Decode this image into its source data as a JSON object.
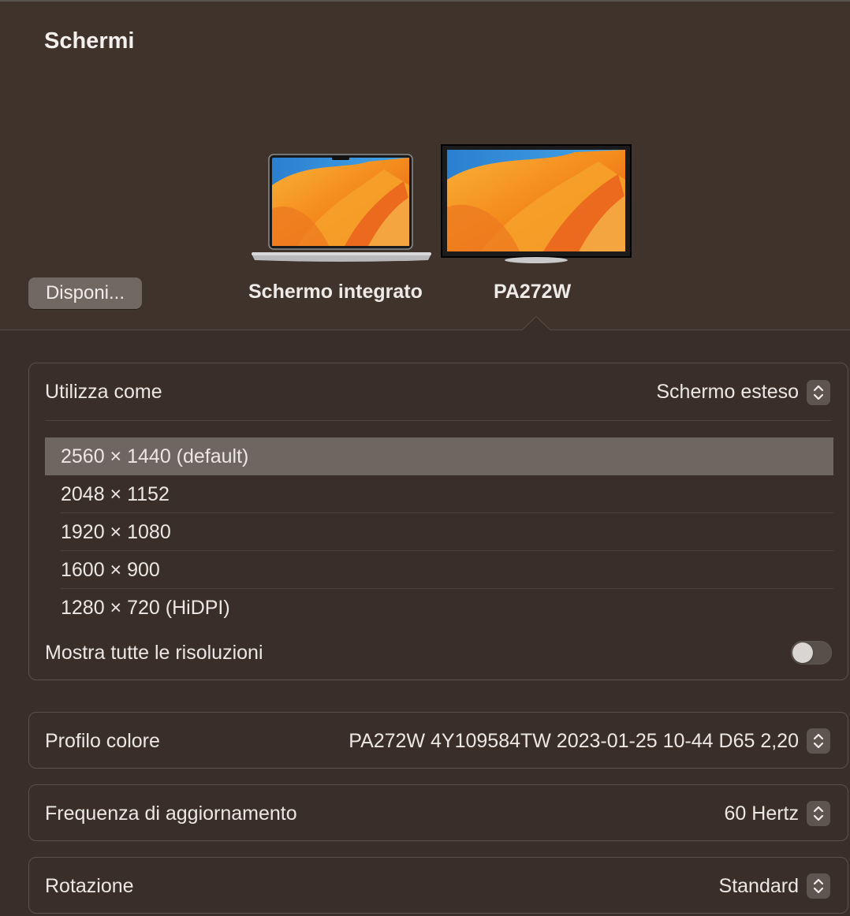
{
  "window": {
    "title": "Schermi"
  },
  "arrange_button": {
    "label": "Disponi..."
  },
  "displays": [
    {
      "label": "Schermo integrato",
      "kind": "laptop",
      "selected": false
    },
    {
      "label": "PA272W",
      "kind": "external-monitor",
      "selected": true
    }
  ],
  "use_as": {
    "label": "Utilizza come",
    "value": "Schermo esteso"
  },
  "resolutions": {
    "items": [
      {
        "label": "2560 × 1440 (default)",
        "selected": true
      },
      {
        "label": "2048 × 1152",
        "selected": false
      },
      {
        "label": "1920 × 1080",
        "selected": false
      },
      {
        "label": "1600 × 900",
        "selected": false
      },
      {
        "label": "1280 × 720 (HiDPI)",
        "selected": false
      }
    ],
    "show_all_label": "Mostra tutte le risoluzioni",
    "show_all_enabled": false
  },
  "color_profile": {
    "label": "Profilo colore",
    "value": "PA272W 4Y109584TW 2023-01-25 10-44 D65 2,20"
  },
  "refresh_rate": {
    "label": "Frequenza di aggiornamento",
    "value": "60 Hertz"
  },
  "rotation": {
    "label": "Rotazione",
    "value": "Standard"
  },
  "colors": {
    "background": "#3a2f28",
    "header_background": "#3f332b",
    "selected_row": "#6d6661",
    "wallpaper_orange": "#f7941d",
    "wallpaper_blue": "#2f8fd8"
  }
}
